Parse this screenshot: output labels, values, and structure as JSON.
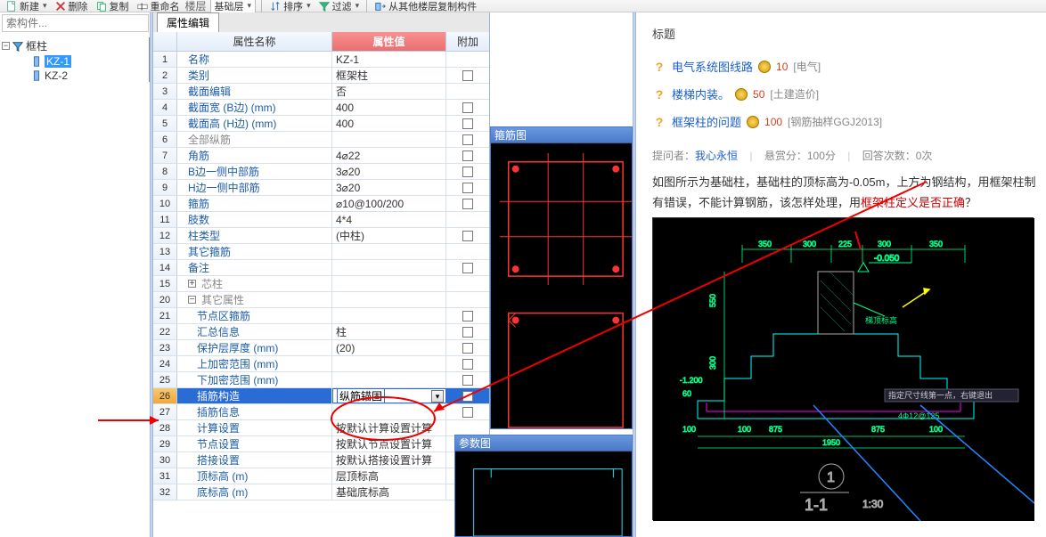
{
  "toolbar": {
    "new": "新建",
    "delete": "删除",
    "copy": "复制",
    "rename": "重命名",
    "layer": "楼层",
    "base_layer": "基础层",
    "sort": "排序",
    "filter": "过滤",
    "copy_from": "从其他楼层复制构件"
  },
  "search": {
    "placeholder": "索构件..."
  },
  "tree": {
    "root": "框柱",
    "items": [
      "KZ-1",
      "KZ-2"
    ]
  },
  "tab": "属性编辑",
  "header": {
    "name": "属性名称",
    "value": "属性值",
    "extra": "附加"
  },
  "rows": [
    {
      "idx": "1",
      "name": "名称",
      "val": "KZ-1",
      "link": true,
      "chk": false
    },
    {
      "idx": "2",
      "name": "类别",
      "val": "框架柱",
      "link": true,
      "chk": true
    },
    {
      "idx": "3",
      "name": "截面编辑",
      "val": "否",
      "link": true,
      "chk": false
    },
    {
      "idx": "4",
      "name": "截面宽 (B边) (mm)",
      "val": "400",
      "link": true,
      "chk": true
    },
    {
      "idx": "5",
      "name": "截面高 (H边) (mm)",
      "val": "400",
      "link": true,
      "chk": true
    },
    {
      "idx": "6",
      "name": "全部纵筋",
      "val": "",
      "link": false,
      "chk": true
    },
    {
      "idx": "7",
      "name": "角筋",
      "val": "4⌀22",
      "link": true,
      "chk": true
    },
    {
      "idx": "8",
      "name": "B边一侧中部筋",
      "val": "3⌀20",
      "link": true,
      "chk": true
    },
    {
      "idx": "9",
      "name": "H边一侧中部筋",
      "val": "3⌀20",
      "link": true,
      "chk": true
    },
    {
      "idx": "10",
      "name": "箍筋",
      "val": "⌀10@100/200",
      "link": true,
      "chk": true
    },
    {
      "idx": "11",
      "name": "肢数",
      "val": "4*4",
      "link": true,
      "chk": false
    },
    {
      "idx": "12",
      "name": "柱类型",
      "val": "(中柱)",
      "link": true,
      "chk": true
    },
    {
      "idx": "13",
      "name": "其它箍筋",
      "val": "",
      "link": true,
      "chk": false
    },
    {
      "idx": "14",
      "name": "备注",
      "val": "",
      "link": true,
      "chk": true
    },
    {
      "idx": "15",
      "name": "芯柱",
      "val": "",
      "grp": "plus",
      "link": false,
      "chk": false
    },
    {
      "idx": "20",
      "name": "其它属性",
      "val": "",
      "grp": "minus",
      "link": false,
      "chk": false
    },
    {
      "idx": "21",
      "name": "节点区箍筋",
      "val": "",
      "link": true,
      "chk": true,
      "indent": true
    },
    {
      "idx": "22",
      "name": "汇总信息",
      "val": "柱",
      "link": true,
      "chk": true,
      "indent": true
    },
    {
      "idx": "23",
      "name": "保护层厚度 (mm)",
      "val": "(20)",
      "link": true,
      "chk": true,
      "indent": true
    },
    {
      "idx": "24",
      "name": "上加密范围 (mm)",
      "val": "",
      "link": true,
      "chk": true,
      "indent": true
    },
    {
      "idx": "25",
      "name": "下加密范围 (mm)",
      "val": "",
      "link": true,
      "chk": true,
      "indent": true
    },
    {
      "idx": "26",
      "name": "插筋构造",
      "val": "纵筋锚固",
      "link": true,
      "chk": true,
      "indent": true,
      "sel": true
    },
    {
      "idx": "27",
      "name": "插筋信息",
      "val": "",
      "link": true,
      "chk": true,
      "indent": true
    },
    {
      "idx": "28",
      "name": "计算设置",
      "val": "按默认计算设置计算",
      "link": true,
      "chk": false,
      "indent": true
    },
    {
      "idx": "29",
      "name": "节点设置",
      "val": "按默认节点设置计算",
      "link": true,
      "chk": false,
      "indent": true
    },
    {
      "idx": "30",
      "name": "搭接设置",
      "val": "按默认搭接设置计算",
      "link": true,
      "chk": false,
      "indent": true
    },
    {
      "idx": "31",
      "name": "顶标高 (m)",
      "val": "层顶标高",
      "link": true,
      "chk": true,
      "indent": true
    },
    {
      "idx": "32",
      "name": "底标高 (m)",
      "val": "基础底标高",
      "link": true,
      "chk": true,
      "indent": true
    }
  ],
  "float1": {
    "title": "箍筋图"
  },
  "float2": {
    "title": "参数图"
  },
  "right": {
    "title": "标题",
    "questions": [
      {
        "text": "电气系统图线路",
        "pts": "10",
        "cat": "[电气]"
      },
      {
        "text": "楼梯内装。",
        "pts": "50",
        "cat": "[土建造价]"
      },
      {
        "text": "框架柱的问题",
        "pts": "100",
        "cat": "[钢筋抽样GGJ2013]"
      }
    ],
    "meta": {
      "asker_label": "提问者：",
      "asker": "我心永恒",
      "bounty": "悬赏分：100分",
      "answers": "回答次数：0次"
    },
    "desc_pre": "如图所示为基础柱，基础柱的顶标高为-0.05m，上方为钢结构，用框架柱制有错误，不能计算钢筋，该怎样处理，用",
    "desc_hl": "框架柱定义是否正确",
    "desc_post": "？",
    "diag": {
      "dims_top": [
        "350",
        "300",
        "225",
        "300",
        "350"
      ],
      "dims_left": [
        "550",
        "300"
      ],
      "dims_bot_main": [
        "100",
        "875",
        "875",
        "100"
      ],
      "dims_bot_total": "1950",
      "dims_left2": [
        "-1.200",
        "60",
        "100"
      ],
      "elev": "-0.050",
      "note_right": "梯顶标高",
      "callout": "指定尺寸线第一点，右键退出",
      "rebar": "4Φ12@125",
      "sec_circle": "1",
      "section": "1-1",
      "scale": "1:30"
    }
  }
}
